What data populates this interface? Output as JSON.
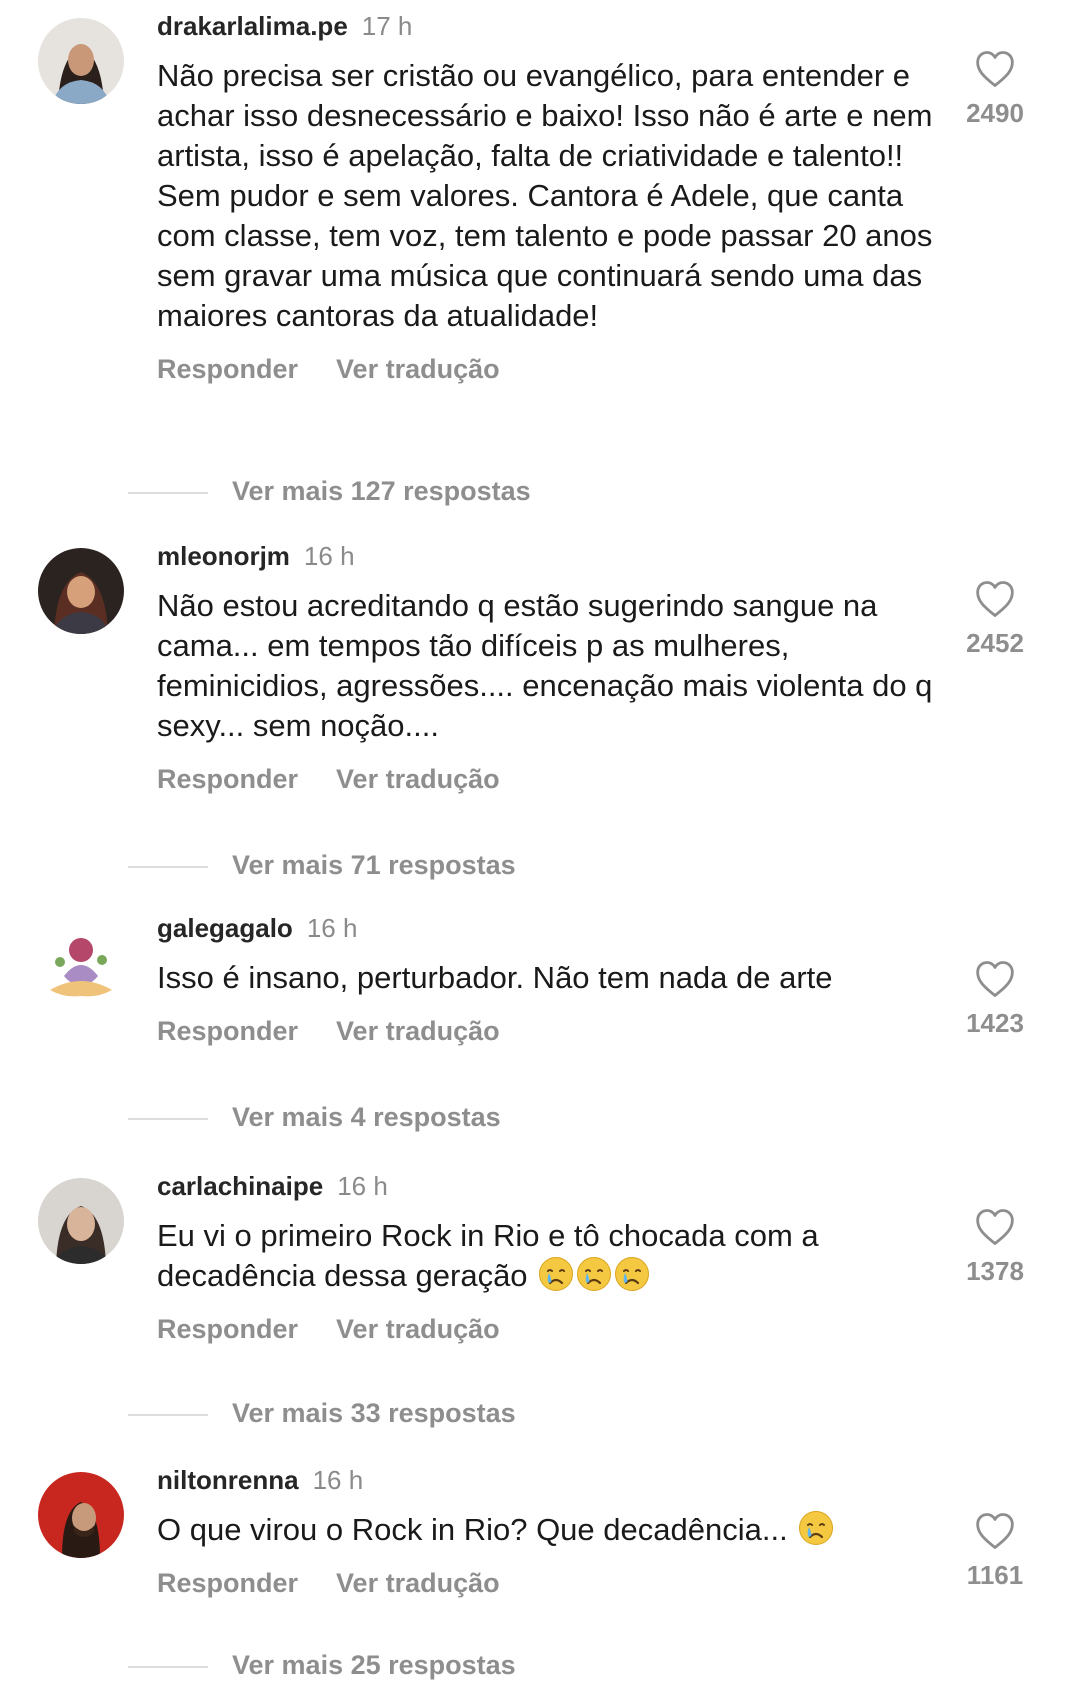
{
  "comments": [
    {
      "username": "drakarlalima.pe",
      "time": "17 h",
      "text": "Não precisa ser cristão ou evangélico, para entender e achar isso desnecessário e baixo! Isso não é arte e nem artista, isso é apelação, falta de criatividade e talento!! Sem pudor e sem valores. Cantora é Adele, que canta com classe, tem voz, tem talento e pode passar 20 anos sem gravar uma música que continuará sendo uma das maiores cantoras da atualidade!",
      "reply_label": "Responder",
      "translate_label": "Ver tradução",
      "more_replies": "Ver mais 127 respostas",
      "likes": "2490"
    },
    {
      "username": "mleonorjm",
      "time": "16 h",
      "text": "Não estou acreditando q estão sugerindo sangue na cama... em tempos tão difíceis p as mulheres, feminicidios, agressões.... encenação mais violenta do q sexy... sem noção....",
      "reply_label": "Responder",
      "translate_label": "Ver tradução",
      "more_replies": "Ver mais 71 respostas",
      "likes": "2452"
    },
    {
      "username": "galegagalo",
      "time": "16 h",
      "text": "Isso é insano, perturbador. Não tem nada de arte",
      "reply_label": "Responder",
      "translate_label": "Ver tradução",
      "more_replies": "Ver mais 4 respostas",
      "likes": "1423"
    },
    {
      "username": "carlachinaipe",
      "time": "16 h",
      "text": "Eu vi o primeiro Rock in Rio e tô chocada com a decadência dessa geração",
      "emoji": [
        "crying-face",
        "crying-face",
        "crying-face"
      ],
      "reply_label": "Responder",
      "translate_label": "Ver tradução",
      "more_replies": "Ver mais 33 respostas",
      "likes": "1378"
    },
    {
      "username": "niltonrenna",
      "time": "16 h",
      "text": "O que virou o Rock in Rio? Que decadência...",
      "emoji": [
        "crying-face"
      ],
      "reply_label": "Responder",
      "translate_label": "Ver tradução",
      "more_replies": "Ver mais 25 respostas",
      "likes": "1161"
    }
  ],
  "colors": {
    "text": "#1a1a1a",
    "muted": "#8e8e8e",
    "username": "#262626",
    "divider": "#dddddd"
  }
}
